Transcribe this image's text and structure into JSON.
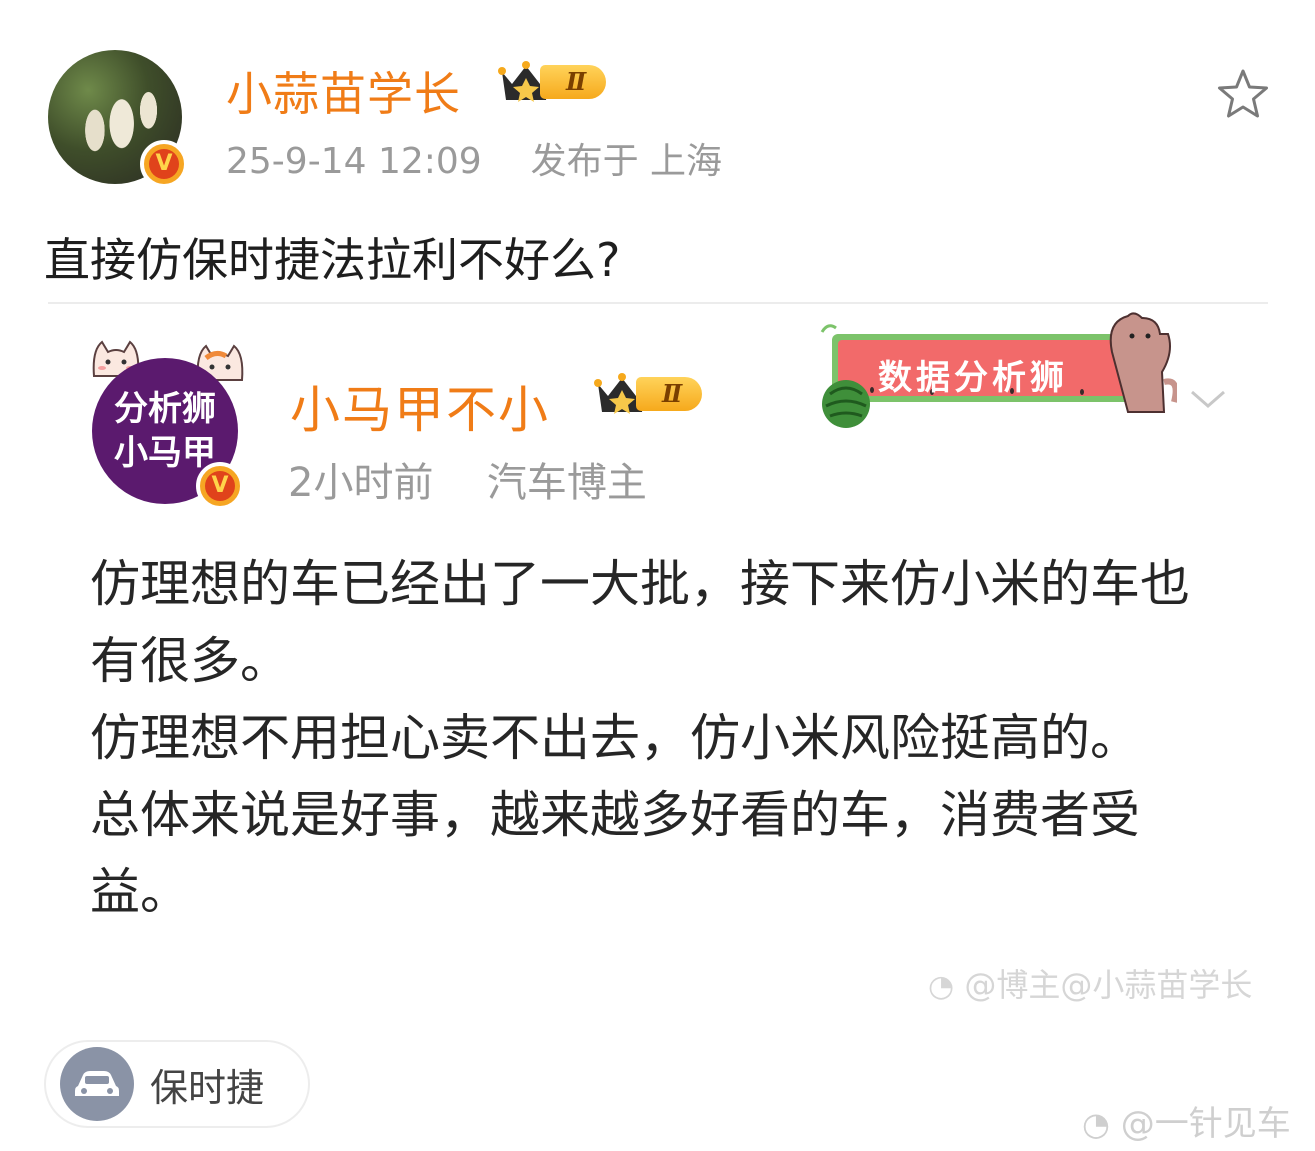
{
  "post": {
    "author": {
      "name": "小蒜苗学长",
      "level_badge": "Ⅱ",
      "verified_mark": "V"
    },
    "timestamp": "25-9-14 12:09",
    "location_text": "发布于 上海",
    "content": "直接仿保时捷法拉利不好么?"
  },
  "repost": {
    "author": {
      "name": "小马甲不小",
      "avatar_line1": "分析狮",
      "avatar_line2": "小马甲",
      "level_badge": "Ⅱ",
      "verified_mark": "V"
    },
    "time_ago": "2小时前",
    "role": "汽车博主",
    "banner_text": "数据分析狮",
    "paragraphs": [
      "仿理想的车已经出了一大批，接下来仿小米的车也有很多。",
      "仿理想不用担心卖不出去，仿小米风险挺高的。",
      "总体来说是好事，越来越多好看的车，消费者受益。"
    ],
    "watermark": "@博主@小蒜苗学长"
  },
  "topic": {
    "label": "保时捷",
    "icon": "car-icon"
  },
  "outer_watermark": "@一针见车",
  "colors": {
    "name_orange": "#f07c17",
    "meta_gray": "#9a9a9a",
    "avatar_purple": "#5b1a6e",
    "badge_gold": "#f6a91c"
  }
}
